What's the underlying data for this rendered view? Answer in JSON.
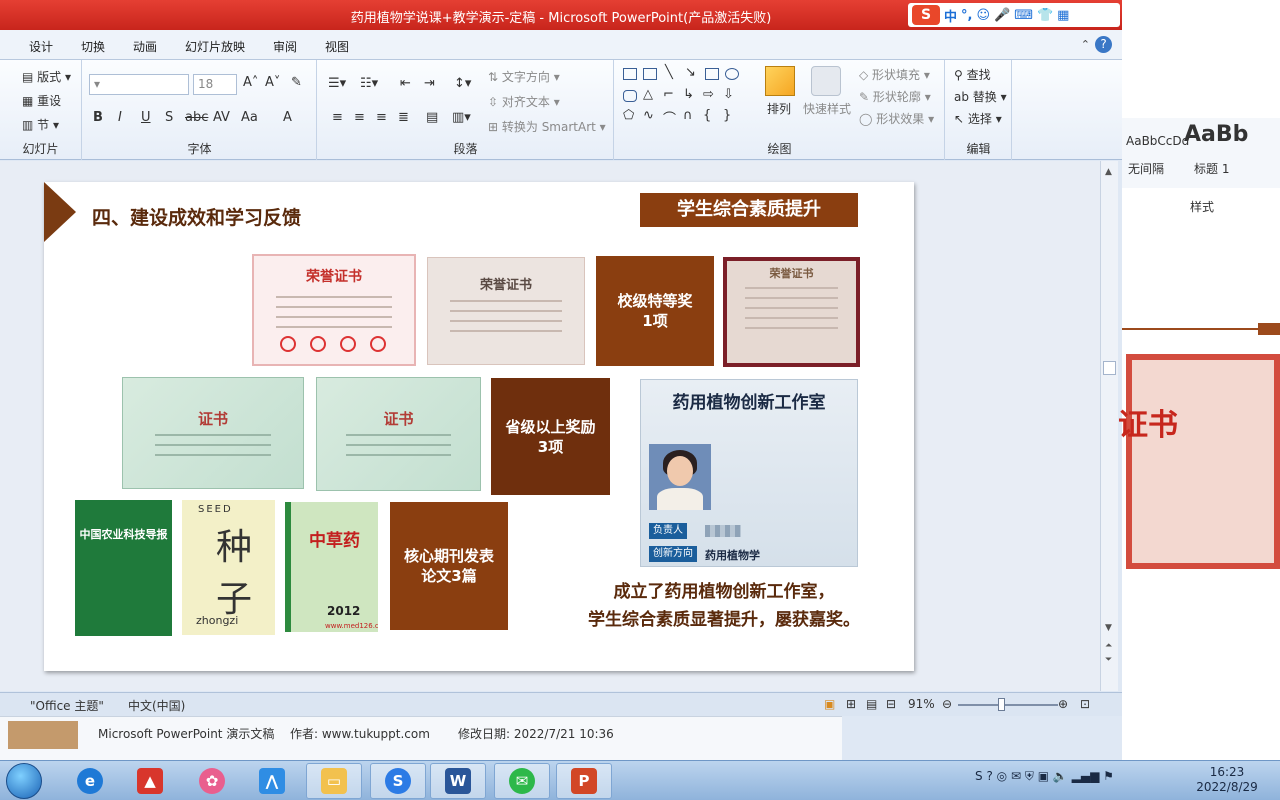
{
  "window": {
    "title": "药用植物学说课+教学演示-定稿 - Microsoft PowerPoint(产品激活失败)"
  },
  "ime": {
    "items": [
      "中",
      "°,",
      "☺",
      "🎤",
      "⌨",
      "👕",
      "▦"
    ]
  },
  "tabs": [
    "设计",
    "切换",
    "动画",
    "幻灯片放映",
    "审阅",
    "视图"
  ],
  "ribbon": {
    "slides_group": {
      "name": "幻灯片",
      "layout": "版式",
      "reset": "重设",
      "section": "节"
    },
    "font_group": {
      "name": "字体",
      "font_size": "18",
      "bold": "B",
      "italic": "I",
      "underline": "U",
      "shadow": "S",
      "strike": "abc",
      "spacing": "AV",
      "case": "Aa",
      "color": "A"
    },
    "paragraph_group": {
      "name": "段落",
      "text_direction": "文字方向",
      "align_text": "对齐文本",
      "smartart": "转换为 SmartArt"
    },
    "drawing_group": {
      "name": "绘图",
      "arrange": "排列",
      "quick_styles": "快速样式",
      "shape_fill": "形状填充",
      "shape_outline": "形状轮廓",
      "shape_effects": "形状效果"
    },
    "editing_group": {
      "name": "编辑",
      "find": "查找",
      "replace": "替换",
      "select": "选择"
    }
  },
  "slide": {
    "heading": "四、建设成效和学习反馈",
    "badge": "学生综合素质提升",
    "cert1_title": "荣誉证书",
    "cert2_title": "荣誉证书",
    "cert3_title": "荣誉证书",
    "green_cert_title": "证书",
    "label_school": "校级特等奖\n1项",
    "label_provincial": "省级以上奖励\n3项",
    "label_journal": "核心期刊发表\n论文3篇",
    "journal1_title": "中国农业科技导报",
    "journal2": {
      "header": "SEED",
      "title": "种子",
      "footer": "zhongzi"
    },
    "journal3": {
      "title": "中草药",
      "year": "2012",
      "url": "www.med126.com"
    },
    "studio": {
      "title": "药用植物创新工作室",
      "person_label": "负责人",
      "direction_label": "创新方向",
      "direction_value": "药用植物学"
    },
    "caption_line1": "成立了药用植物创新工作室，",
    "caption_line2": "学生综合素质显著提升，屡获嘉奖。"
  },
  "statusbar": {
    "theme": "\"Office 主题\"",
    "language": "中文(中国)",
    "zoom": "91%"
  },
  "right_window": {
    "style1": "AaBbCcDd",
    "style1_name": "无间隔",
    "style2": "AaBb",
    "style2_name": "标题 1",
    "styles_label": "样式",
    "cert_text": "证书"
  },
  "infobar": {
    "doc_type": "Microsoft PowerPoint 演示文稿",
    "author": "作者: www.tukuppt.com",
    "modified": "修改日期: 2022/7/21 10:36"
  },
  "taskbar": {
    "time": "16:23",
    "date": "2022/8/29"
  },
  "colors": {
    "title_bar": "#d4302a",
    "accent_brown": "#8a3e10",
    "dark_brown": "#6f2f0d"
  }
}
